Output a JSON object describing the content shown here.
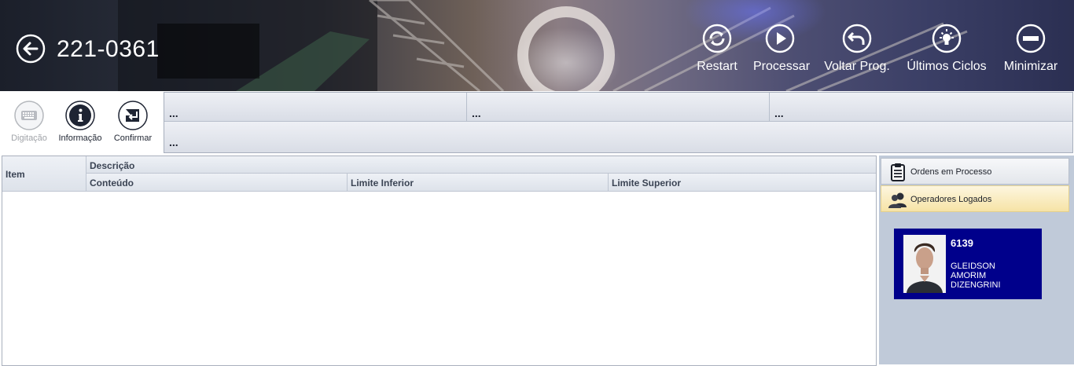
{
  "header": {
    "title": "221-0361",
    "buttons": [
      {
        "label": "Restart",
        "icon": "restart-icon"
      },
      {
        "label": "Processar",
        "icon": "play-icon"
      },
      {
        "label": "Voltar Prog.",
        "icon": "undo-arrow-icon"
      },
      {
        "label": "Últimos Ciclos",
        "icon": "lightbulb-icon"
      },
      {
        "label": "Minimizar",
        "icon": "minus-icon"
      }
    ]
  },
  "toolbar": {
    "buttons": [
      {
        "label": "Digitação",
        "icon": "keyboard-icon",
        "enabled": false
      },
      {
        "label": "Informação",
        "icon": "info-icon",
        "enabled": true
      },
      {
        "label": "Confirmar",
        "icon": "enter-key-icon",
        "enabled": true
      }
    ],
    "info_fields": [
      "...",
      "...",
      "...",
      "..."
    ]
  },
  "table": {
    "headers": {
      "item": "Item",
      "descricao": "Descrição",
      "conteudo": "Conteúdo",
      "limite_inferior": "Limite Inferior",
      "limite_superior": "Limite Superior"
    },
    "rows": []
  },
  "side_panel": {
    "tabs": [
      {
        "label": "Ordens em Processo",
        "icon": "clipboard-icon"
      },
      {
        "label": "Operadores Logados",
        "icon": "users-icon",
        "active": true
      }
    ],
    "operator": {
      "id": "6139",
      "name_lines": [
        "GLEIDSON",
        "AMORIM",
        "DIZENGRINI"
      ]
    }
  },
  "colors": {
    "operator_card_bg": "#00008b",
    "side_panel_bg": "#c0cad9",
    "active_tab": "#f6e3a6"
  }
}
